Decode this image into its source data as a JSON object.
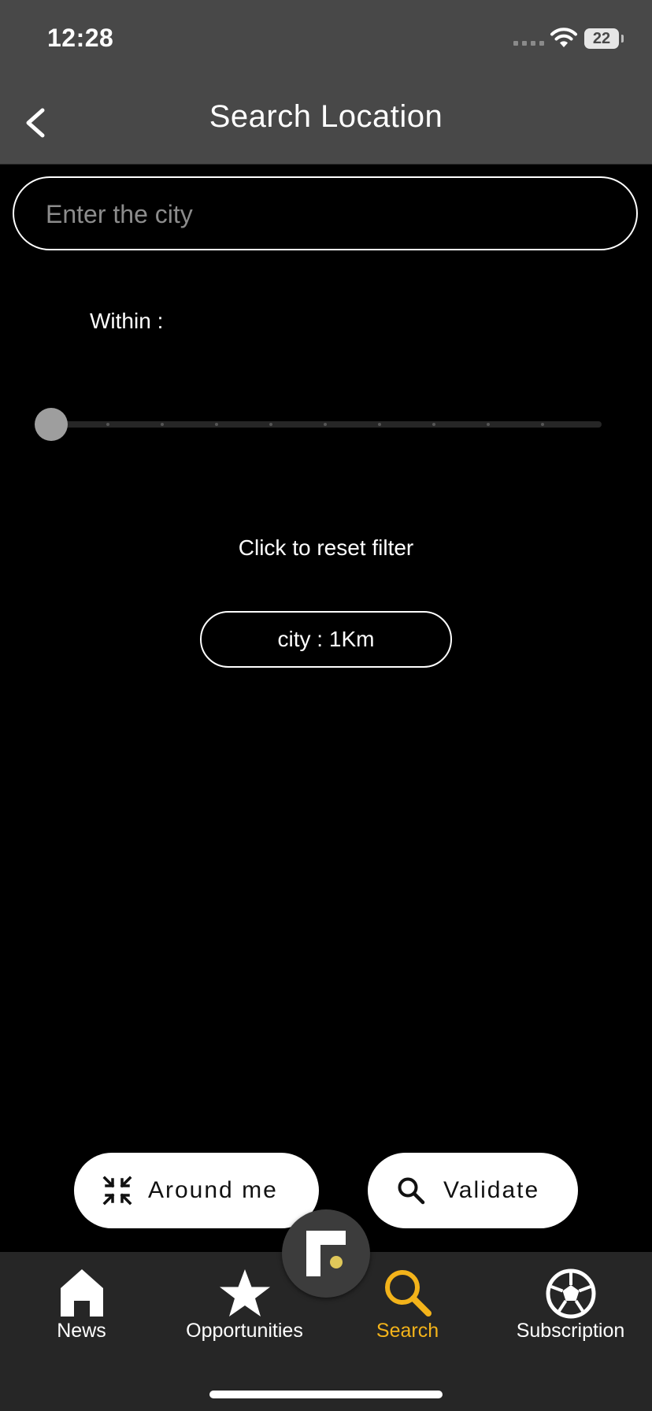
{
  "status_bar": {
    "time": "12:28",
    "battery": "22"
  },
  "header": {
    "title": "Search Location"
  },
  "search": {
    "placeholder": "Enter the city",
    "value": ""
  },
  "filter": {
    "within_label": "Within :",
    "slider_level": 0,
    "reset_label": "Click to reset filter",
    "chip_label": "city : 1Km"
  },
  "actions": {
    "around_me": "Around me",
    "validate": "Validate"
  },
  "tabs": [
    {
      "label": "News",
      "icon": "home-icon",
      "active": false
    },
    {
      "label": "Opportunities",
      "icon": "star-icon",
      "active": false
    },
    {
      "label": "Search",
      "icon": "search-icon",
      "active": true
    },
    {
      "label": "Subscription",
      "icon": "soccer-ball-icon",
      "active": false
    }
  ],
  "colors": {
    "accent": "#f3b31a",
    "header_bg": "#484848",
    "tab_bar_bg": "#262626",
    "background": "#000000"
  }
}
